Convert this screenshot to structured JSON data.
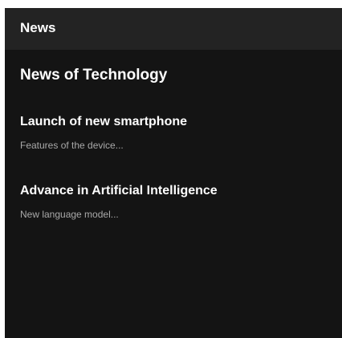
{
  "app_bar": {
    "title": "News"
  },
  "main": {
    "section_title": "News of Technology",
    "items": [
      {
        "title": "Launch of new smartphone",
        "subtitle": "Features of the device..."
      },
      {
        "title": "Advance in Artificial Intelligence",
        "subtitle": "New language model..."
      }
    ]
  },
  "colors": {
    "background": "#141414",
    "app_bar": "#232323",
    "text_primary": "#ffffff",
    "text_secondary": "#a9a9a9"
  }
}
